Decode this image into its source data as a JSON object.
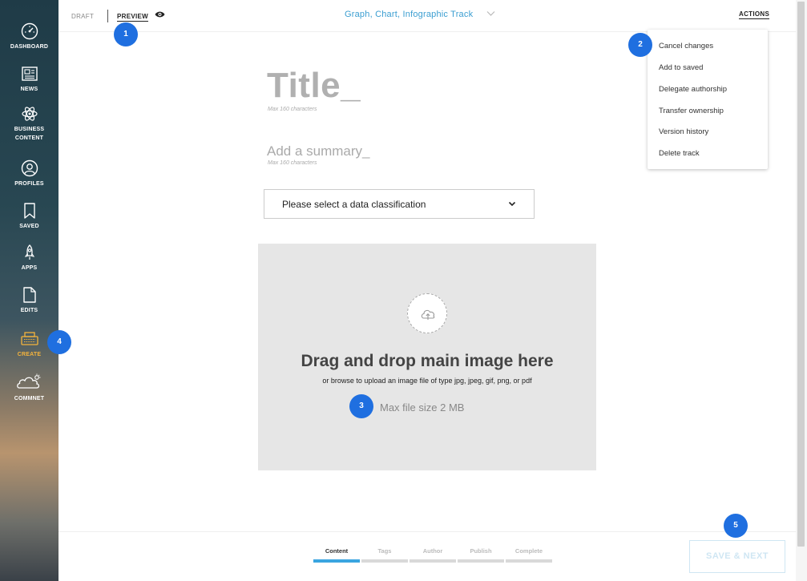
{
  "sidebar": {
    "items": [
      {
        "label": "DASHBOARD",
        "icon": "dashboard-gauge-icon"
      },
      {
        "label": "NEWS",
        "icon": "newspaper-icon"
      },
      {
        "label": "BUSINESS",
        "label2": "CONTENT",
        "icon": "atom-icon"
      },
      {
        "label": "PROFILES",
        "icon": "user-circle-icon"
      },
      {
        "label": "SAVED",
        "icon": "bookmark-icon"
      },
      {
        "label": "APPS",
        "icon": "rocket-icon"
      },
      {
        "label": "EDITS",
        "icon": "document-icon"
      },
      {
        "label": "CREATE",
        "icon": "typewriter-icon",
        "active": true
      },
      {
        "label": "COMMNET",
        "icon": "comment-cloud-icon"
      }
    ],
    "active_color": "#f5b43c"
  },
  "topbar": {
    "draft_label": "DRAFT",
    "preview_label": "PREVIEW",
    "track_title": "Graph, Chart, Infographic Track",
    "actions_label": "ACTIONS"
  },
  "editor": {
    "title_placeholder": "Title_",
    "title_hint": "Max 160 characters",
    "summary_placeholder": "Add a summary_",
    "summary_hint": "Max 160 characters",
    "classification_placeholder": "Please select a data classification"
  },
  "dropzone": {
    "title": "Drag and drop main image here",
    "subtitle": "or browse to upload an image file of type jpg, jpeg, gif, png, or pdf",
    "max_size": "Max file size 2 MB"
  },
  "actions_menu": {
    "items": [
      "Cancel changes",
      "Add to saved",
      "Delegate authorship",
      "Transfer ownership",
      "Version history",
      "Delete track"
    ]
  },
  "markers": [
    "1",
    "2",
    "3",
    "4",
    "5"
  ],
  "steps": {
    "items": [
      "Content",
      "Tags",
      "Author",
      "Publish",
      "Complete"
    ],
    "active_index": 0
  },
  "save_next_label": "SAVE & NEXT",
  "colors": {
    "accent_blue": "#3b9ed1",
    "marker_blue": "#1f6fe0",
    "progress_blue": "#3aa5e0"
  }
}
